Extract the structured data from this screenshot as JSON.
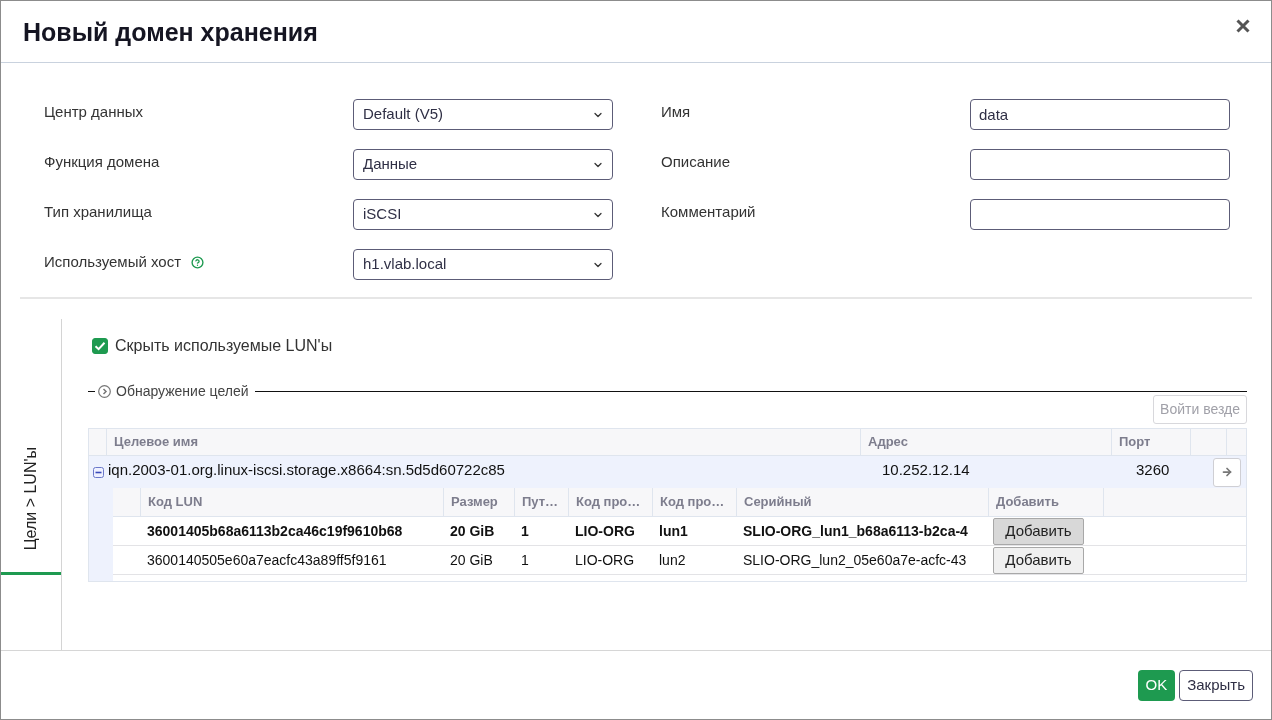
{
  "dialog": {
    "title": "Новый домен хранения"
  },
  "form": {
    "left": [
      {
        "label": "Центр данных",
        "kind": "select",
        "value": "Default (V5)",
        "help": false
      },
      {
        "label": "Функция домена",
        "kind": "select",
        "value": "Данные",
        "help": false
      },
      {
        "label": "Тип хранилища",
        "kind": "select",
        "value": "iSCSI",
        "help": false
      },
      {
        "label": "Используемый хост",
        "kind": "select",
        "value": "h1.vlab.local",
        "help": true
      }
    ],
    "right": [
      {
        "label": "Имя",
        "kind": "input",
        "value": "data"
      },
      {
        "label": "Описание",
        "kind": "input"
      },
      {
        "label": "Комментарий",
        "kind": "input"
      }
    ]
  },
  "side_tabs": [
    {
      "label": "Цели > LUN'ы",
      "selected": true
    }
  ],
  "hide_used_luns": {
    "label": "Скрыть используемые LUN'ы",
    "checked": true
  },
  "discovery": {
    "label": "Обнаружение целей",
    "expanded": false
  },
  "login_all_button": {
    "label": "Войти везде",
    "disabled": true
  },
  "targets": {
    "columns": [
      "Целевое имя",
      "Адрес",
      "Порт"
    ],
    "rows": [
      {
        "name": "iqn.2003-01.org.linux-iscsi.storage.x8664:sn.5d5d60722c85",
        "address": "10.252.12.14",
        "port": "3260",
        "expanded": true,
        "luns": {
          "columns": [
            "Код LUN",
            "Размер",
            "Пут…",
            "Код про…",
            "Код про…",
            "Серийный",
            "Добавить"
          ],
          "rows": [
            {
              "selected": true,
              "cells": [
                "36001405b68a6113b2ca46c19f9610b68",
                "20 GiB",
                "1",
                "LIO-ORG",
                "lun1",
                "SLIO-ORG_lun1_b68a6113-b2ca-4"
              ],
              "button": "Добавить"
            },
            {
              "selected": false,
              "cells": [
                "3600140505e60a7eacfc43a89ff5f9161",
                "20 GiB",
                "1",
                "LIO-ORG",
                "lun2",
                "SLIO-ORG_lun2_05e60a7e-acfc-43"
              ],
              "button": "Добавить"
            }
          ]
        }
      }
    ]
  },
  "footer": {
    "buttons": [
      {
        "label": "OK",
        "kind": "primary"
      },
      {
        "label": "Закрыть",
        "kind": "secondary"
      }
    ]
  }
}
